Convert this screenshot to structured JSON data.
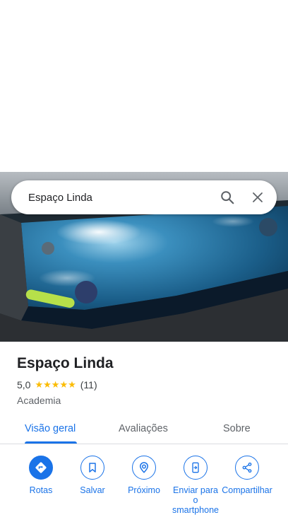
{
  "search": {
    "query": "Espaço Linda"
  },
  "place": {
    "name": "Espaço Linda",
    "rating": "5,0",
    "stars": 5,
    "review_count": "(11)",
    "category": "Academia"
  },
  "tabs": [
    {
      "label": "Visão geral",
      "active": true
    },
    {
      "label": "Avaliações",
      "active": false
    },
    {
      "label": "Sobre",
      "active": false
    }
  ],
  "actions": [
    {
      "label": "Rotas",
      "icon": "directions-icon"
    },
    {
      "label": "Salvar",
      "icon": "bookmark-icon"
    },
    {
      "label": "Próximo",
      "icon": "nearby-icon"
    },
    {
      "label": "Enviar para o smartphone",
      "icon": "send-to-phone-icon"
    },
    {
      "label": "Compartilhar",
      "icon": "share-icon"
    }
  ],
  "colors": {
    "accent": "#1a73e8",
    "star": "#fbbc04"
  }
}
